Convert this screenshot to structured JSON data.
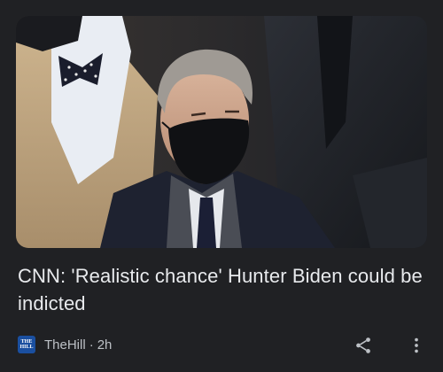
{
  "article": {
    "headline": "CNN: 'Realistic chance' Hunter Biden could be indicted",
    "source": "TheHill",
    "separator": "·",
    "age": "2h",
    "source_logo_lines": [
      "THE",
      "HILL"
    ]
  },
  "icons": {
    "share": "share-icon",
    "more": "more-vertical-icon"
  },
  "colors": {
    "background": "#202124",
    "headline": "#e8eaed",
    "meta": "#bdc1c6",
    "source_logo": "#1a4fa0"
  }
}
